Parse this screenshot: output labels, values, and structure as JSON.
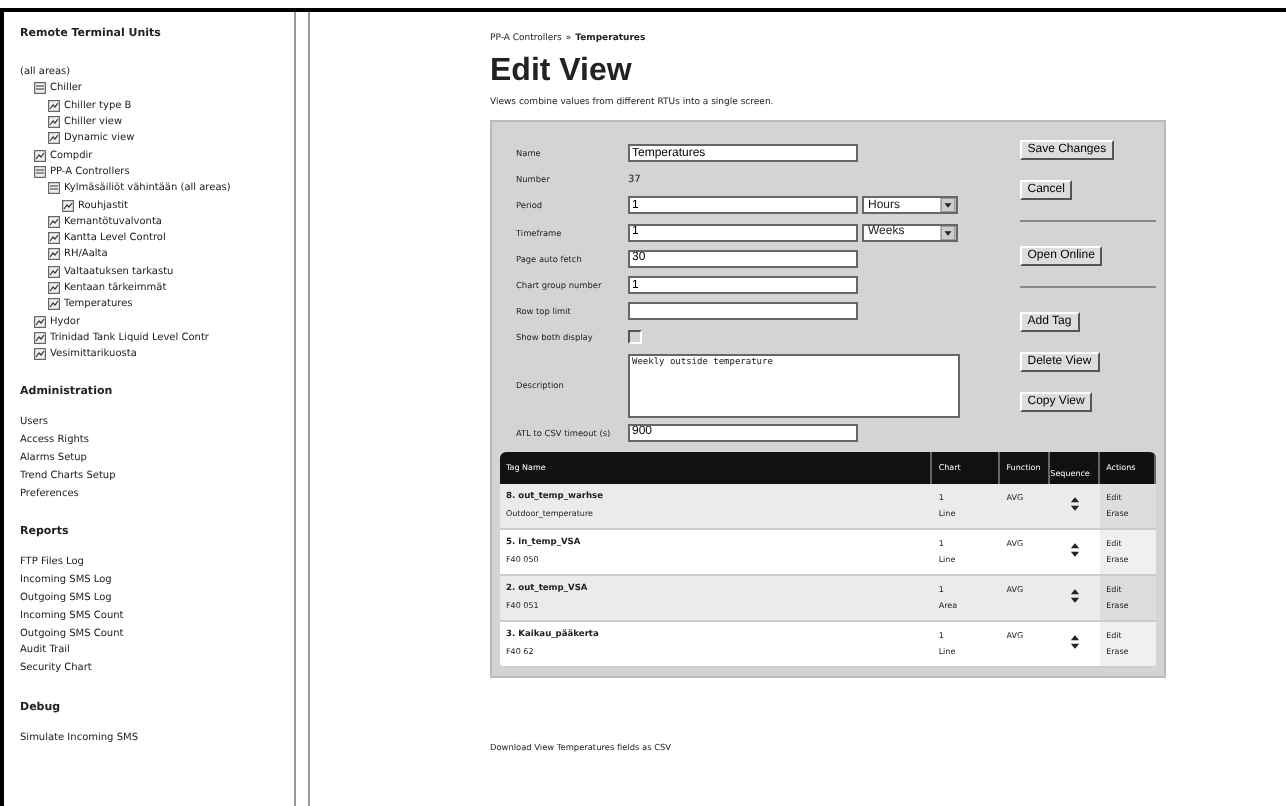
{
  "sidebar": {
    "title": "Remote Terminal Units",
    "tree": [
      {
        "label": "(all areas)",
        "children": [
          {
            "label": "Chiller",
            "children": [
              {
                "label": "Chiller type B"
              },
              {
                "label": "Chiller view"
              },
              {
                "label": "Dynamic view"
              }
            ]
          },
          {
            "label": "Compdir"
          },
          {
            "label": "PP-A Controllers",
            "children": [
              {
                "label": "Kylmäsäiliöt vähintään (all areas)",
                "children": [
                  {
                    "label": "Rouhjastit"
                  }
                ]
              },
              {
                "label": "Kemantötuvalvonta"
              },
              {
                "label": "Kantta Level Control"
              },
              {
                "label": "RH/Aalta"
              },
              {
                "label": "Valtaatuksen tarkastu"
              },
              {
                "label": "Kentaan tärkeimmät"
              },
              {
                "label": "Temperatures"
              }
            ]
          },
          {
            "label": "Hydor"
          },
          {
            "label": "Trinidad Tank Liquid Level Contr"
          },
          {
            "label": "Vesimittarikuosta"
          }
        ]
      }
    ],
    "sections": [
      {
        "title": "Administration",
        "links": [
          "Users",
          "Access Rights",
          "Alarms Setup",
          "Trend Charts Setup",
          "Preferences"
        ]
      },
      {
        "title": "Reports",
        "links": [
          "FTP Files Log",
          "Incoming SMS Log",
          "Outgoing SMS Log",
          "Incoming SMS Count",
          "Outgoing SMS Count",
          "Audit Trail",
          "Security Chart"
        ]
      },
      {
        "title": "Debug",
        "links": [
          "Simulate Incoming SMS"
        ]
      }
    ]
  },
  "breadcrumb": {
    "parent": "PP-A Controllers",
    "separator": "»",
    "current": "Temperatures"
  },
  "title": "Edit View",
  "subtitle": "Views combine values from different RTUs into a single screen.",
  "form": {
    "fields": [
      {
        "kind": "text",
        "label": "Name",
        "value": "Temperatures"
      },
      {
        "kind": "static",
        "label": "Number",
        "value": "37"
      },
      {
        "kind": "text-select",
        "label": "Period",
        "value": "1",
        "unit": "Hours"
      },
      {
        "kind": "text-select",
        "label": "Timeframe",
        "value": "1",
        "unit": "Weeks"
      },
      {
        "kind": "text",
        "label": "Page auto fetch",
        "value": "30"
      },
      {
        "kind": "text",
        "label": "Chart group number",
        "value": "1"
      },
      {
        "kind": "text",
        "label": "Row top limit"
      },
      {
        "kind": "checkbox",
        "label": "Show both display",
        "checked": false
      },
      {
        "kind": "textarea",
        "label": "Description",
        "value": "Weekly outside temperature"
      },
      {
        "kind": "text",
        "label": "ATL to CSV timeout (s)",
        "value": "900"
      }
    ],
    "buttons": [
      {
        "kind": "button",
        "label": "Save Changes"
      },
      {
        "kind": "button",
        "label": "Cancel"
      },
      {
        "kind": "divider"
      },
      {
        "kind": "button",
        "label": "Open Online"
      },
      {
        "kind": "divider"
      },
      {
        "kind": "button",
        "label": "Add Tag"
      },
      {
        "kind": "button",
        "label": "Delete View"
      },
      {
        "kind": "button",
        "label": "Copy View"
      }
    ]
  },
  "table": {
    "columns": [
      "Tag Name",
      "Chart",
      "Function",
      "Sequence",
      "Actions"
    ],
    "rows": [
      {
        "tag": "8. out_temp_warhse",
        "description": "Outdoor_temperature",
        "chart": "1",
        "chart_type": "Line",
        "function": "AVG",
        "actions": [
          "Edit",
          "Erase"
        ]
      },
      {
        "tag": "5. in_temp_VSA",
        "description": "F40 050",
        "chart": "1",
        "chart_type": "Line",
        "function": "AVG",
        "actions": [
          "Edit",
          "Erase"
        ]
      },
      {
        "tag": "2. out_temp_VSA",
        "description": "F40 051",
        "chart": "1",
        "chart_type": "Area",
        "function": "AVG",
        "actions": [
          "Edit",
          "Erase"
        ]
      },
      {
        "tag": "3. Kaikau_pääkerta",
        "description": "F40 62",
        "chart": "1",
        "chart_type": "Line",
        "function": "AVG",
        "actions": [
          "Edit",
          "Erase"
        ]
      }
    ]
  },
  "footer_link": "Download View Temperatures fields as CSV"
}
